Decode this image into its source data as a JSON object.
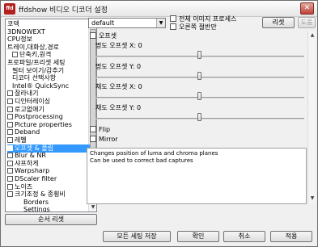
{
  "window": {
    "title": "ffdshow 비디오 디코더 설정",
    "app_icon": "ffd",
    "close_label": "✕"
  },
  "tree": {
    "items": [
      {
        "label": "코덱",
        "checkbox": false
      },
      {
        "label": "3DNOWEXT",
        "checkbox": false
      },
      {
        "label": "CPU정보",
        "checkbox": false
      },
      {
        "label": "트레이,대화상,경로",
        "checkbox": false
      },
      {
        "label": "단축키,원격",
        "checkbox": true
      },
      {
        "label": "프로파일/프리셋 세팅",
        "checkbox": false
      },
      {
        "label": "필터 보이기/감추기",
        "checkbox": false
      },
      {
        "label": "디코더 선택사항",
        "checkbox": false
      },
      {
        "label": "Intel® QuickSync",
        "checkbox": false
      },
      {
        "label": "잘라내기",
        "checkbox": true
      },
      {
        "label": "디인터레이싱",
        "checkbox": true
      },
      {
        "label": "로고없애기",
        "checkbox": true
      },
      {
        "label": "Postprocessing",
        "checkbox": true
      },
      {
        "label": "Picture properties",
        "checkbox": true
      },
      {
        "label": "Deband",
        "checkbox": true
      },
      {
        "label": "레벨",
        "checkbox": true
      },
      {
        "label": "오프셋 & 플립",
        "checkbox": true,
        "selected": true
      },
      {
        "label": "Blur & NR",
        "checkbox": true
      },
      {
        "label": "샤프하게",
        "checkbox": true
      },
      {
        "label": "Warpsharp",
        "checkbox": true
      },
      {
        "label": "DScaler filter",
        "checkbox": true
      },
      {
        "label": "노이즈",
        "checkbox": true
      },
      {
        "label": "크기조정 & 종횡비",
        "checkbox": true
      },
      {
        "label": "Borders",
        "checkbox": false
      },
      {
        "label": "Settings",
        "checkbox": false
      }
    ]
  },
  "reset_order_button": "순서 리셋",
  "preset_combo": {
    "value": "default"
  },
  "options": {
    "whole_image": "전체 이미지 프로세스",
    "right_half": "오른쪽 절반만"
  },
  "reset_button": "리셋",
  "help_button": "도움말",
  "offset_section": {
    "enable_label": "오프셋",
    "sliders": [
      {
        "label": "명도 오프셋 X: 0",
        "value": 0,
        "range": [
          -32,
          32
        ]
      },
      {
        "label": "명도 오프셋 Y: 0",
        "value": 0,
        "range": [
          -32,
          32
        ]
      },
      {
        "label": "채도 오프셋 X: 0",
        "value": 0,
        "range": [
          -32,
          32
        ]
      },
      {
        "label": "채도 오프셋 Y: 0",
        "value": 0,
        "range": [
          -32,
          32
        ]
      }
    ],
    "flip_label": "Flip",
    "mirror_label": "Mirror"
  },
  "description": {
    "line1": "Changes position of luma and chroma planes",
    "line2": "Can be used to correct bad captures"
  },
  "bottom_buttons": {
    "save_all": "모든 세팅 저장",
    "ok": "확인",
    "cancel": "취소",
    "apply": "적용"
  }
}
